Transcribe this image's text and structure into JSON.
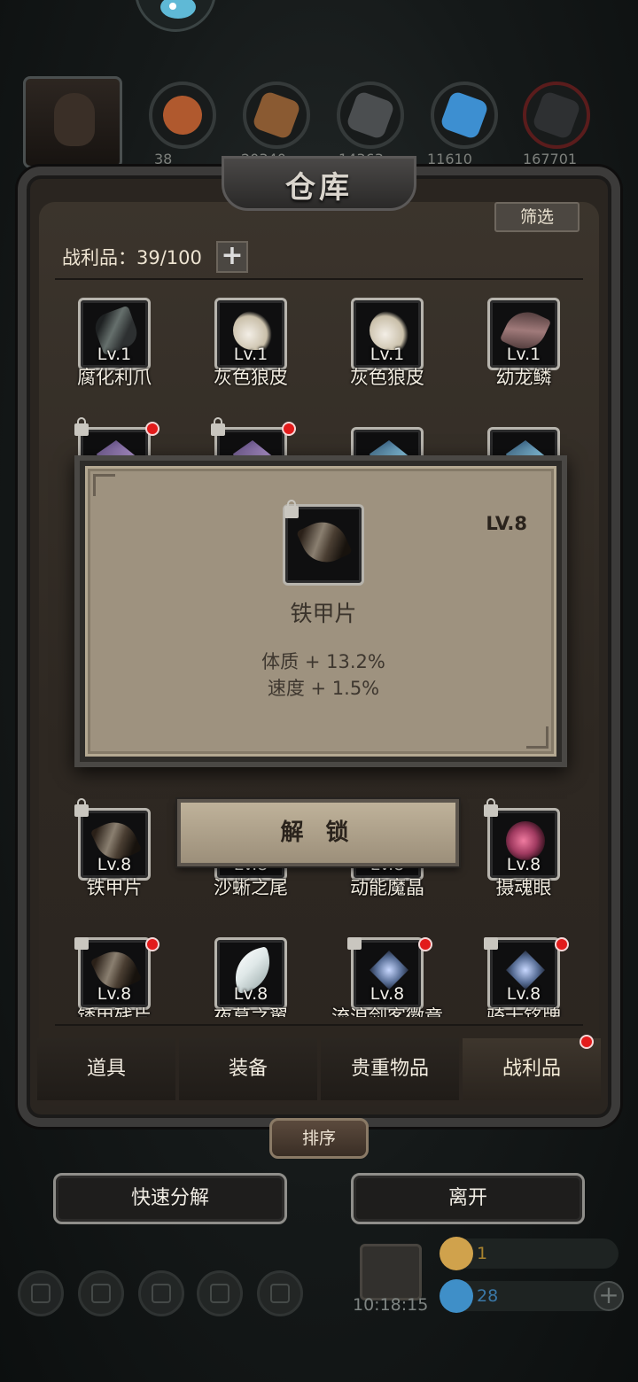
{
  "header": {
    "title": "仓库",
    "filter_label": "筛选",
    "loot_label": "战利品：39/100",
    "add_label": "+"
  },
  "resources": [
    {
      "icon": "meat-icon",
      "count": "38",
      "color": "#b0592e"
    },
    {
      "icon": "wood-icon",
      "count": "20340",
      "color": "#8a5a32"
    },
    {
      "icon": "iron-icon",
      "count": "14363",
      "color": "#4b4e50"
    },
    {
      "icon": "crystal-icon",
      "count": "11610",
      "color": "#3d8fd1"
    },
    {
      "icon": "steel-icon",
      "count": "167701",
      "color": "#2e3032"
    }
  ],
  "items": {
    "row1": [
      {
        "lv": "Lv.1",
        "name": "腐化利爪",
        "art": "claw"
      },
      {
        "lv": "Lv.1",
        "name": "灰色狼皮",
        "art": "fur"
      },
      {
        "lv": "Lv.1",
        "name": "灰色狼皮",
        "art": "fur"
      },
      {
        "lv": "Lv.1",
        "name": "幼龙鳞",
        "art": "scale"
      }
    ],
    "row4": [
      {
        "lv": "Lv.8",
        "name": "铁甲片",
        "art": "plate"
      },
      {
        "lv": "Lv.8",
        "name": "沙蜥之尾",
        "art": "plate"
      },
      {
        "lv": "Lv.8",
        "name": "动能魔晶",
        "art": "crystal-blue"
      },
      {
        "lv": "Lv.8",
        "name": "摄魂眼",
        "art": "eye"
      }
    ],
    "row5": [
      {
        "lv": "Lv.8",
        "name": "锈甲残片",
        "art": "plate"
      },
      {
        "lv": "Lv.8",
        "name": "夜幕之翼",
        "art": "wing"
      },
      {
        "lv": "Lv.8",
        "name": "流浪剑客徽章",
        "art": "badge"
      },
      {
        "lv": "Lv.8",
        "name": "骑士铭牌",
        "art": "badge"
      }
    ]
  },
  "popup": {
    "level": "LV.8",
    "name": "铁甲片",
    "stat1": "体质 + 13.2%",
    "stat2": "速度 + 1.5%",
    "unlock_label": "解 锁"
  },
  "tabs": [
    {
      "label": "道具",
      "active": false
    },
    {
      "label": "装备",
      "active": false
    },
    {
      "label": "贵重物品",
      "active": false
    },
    {
      "label": "战利品",
      "active": true
    }
  ],
  "sort_label": "排序",
  "buttons": {
    "quick_decompose": "快速分解",
    "leave": "离开"
  },
  "dock": {
    "timer": "10:18:15",
    "currency1": "1",
    "currency2": "28",
    "plus": "+"
  }
}
